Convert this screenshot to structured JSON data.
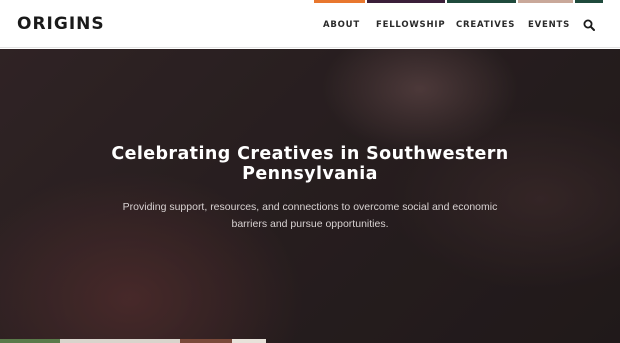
{
  "header": {
    "logo": "ORIGINS",
    "nav": [
      "ABOUT",
      "FELLOWSHIP",
      "CREATIVES",
      "EVENTS"
    ],
    "search_icon": "search-icon",
    "accent_colors": [
      "#e8772e",
      "#3b1f3a",
      "#1f4a3c",
      "#c9a89a",
      "#1f4a3c"
    ]
  },
  "hero": {
    "title": "Celebrating Creatives in Southwestern Pennsylvania",
    "subtitle": "Providing support, resources, and connections to overcome social and economic barriers and pursue opportunities."
  }
}
